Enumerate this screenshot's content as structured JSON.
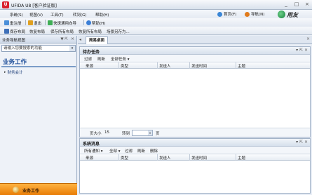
{
  "window": {
    "app_icon_text": "U",
    "title": "UFIDA U8 [客户验证版]",
    "minimize": "_",
    "maximize": "□",
    "close": "×"
  },
  "menu": {
    "items": [
      "系统(S)",
      "视图(V)",
      "工具(T)",
      "转到(G)",
      "帮助(H)"
    ],
    "home": "首页(F)",
    "navigate": "导航(N)",
    "logo": "用友"
  },
  "toolbar1": {
    "items": [
      "重注册",
      "退出",
      "快速通用向导",
      "帮助(H)"
    ]
  },
  "toolbar2": {
    "items": [
      "保存布局",
      "恢复布局",
      "保存所有布局",
      "恢复所有布局",
      "场景另存为..."
    ]
  },
  "sidebar": {
    "title": "业务导航视图",
    "pin": "▼ ⇱",
    "close": "×",
    "search_placeholder": "请输入您要搜索的功能",
    "search_btn": "▾",
    "section_title": "业务工作",
    "item": "财务会计",
    "bottom_label": "业务工作"
  },
  "tabs": {
    "arrow": "◂",
    "active": "简易桌面",
    "close": "×"
  },
  "todo_panel": {
    "title": "待办任务",
    "ctrl": "▾ ⇱ ×",
    "actions": [
      "过滤",
      "刷新",
      "全部任务 ▾"
    ],
    "columns": [
      "来源",
      "类型",
      "发送人",
      "发送时间",
      "主题"
    ],
    "pager": {
      "page_size_label": "页大小",
      "page_size": "15",
      "goto_label": "转到",
      "page_label": "页",
      "dd": "▾"
    }
  },
  "msg_panel": {
    "title": "系统消息",
    "ctrl": "▾ ⇱ ×",
    "actions": [
      "所有通知 ▾",
      "全部 ▾",
      "过滤",
      "刷新",
      "删除"
    ],
    "columns": [
      "来源",
      "类型",
      "发送人",
      "发送时间",
      "主题"
    ]
  },
  "icon_colors": {
    "reregister": "#4a8fd9",
    "exit": "#e0a020",
    "wizard": "#3fae55",
    "help": "#3a7ed6",
    "save": "#3d6fb8"
  }
}
